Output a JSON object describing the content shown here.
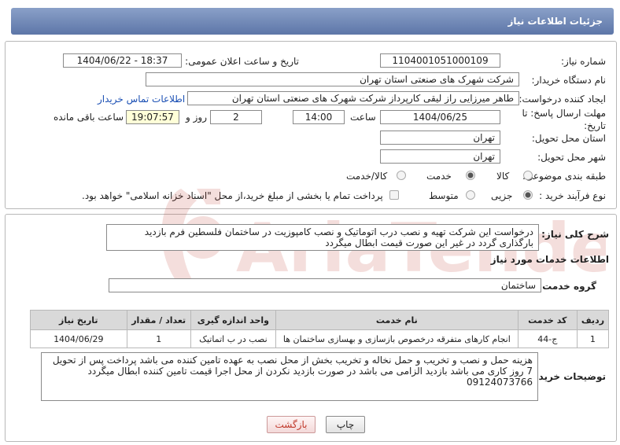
{
  "header": {
    "title": "جزئیات اطلاعات نیاز"
  },
  "form": {
    "need_number_label": "شماره نیاز:",
    "need_number": "1104001051000109",
    "announce_label": "تاریخ و ساعت اعلان عمومی:",
    "announce_value": "1404/06/22 - 18:37",
    "buyer_org_label": "نام دستگاه خریدار:",
    "buyer_org": "شرکت شهرک های صنعتی استان تهران",
    "creator_label": "ایجاد کننده درخواست:",
    "creator": "طاهر  میرزایی راز لیقی کارپرداز شرکت شهرک های صنعتی استان تهران",
    "contact_link": "اطلاعات تماس خریدار",
    "deadline_label": "مهلت ارسال پاسخ: تا تاریخ:",
    "deadline_date": "1404/06/25",
    "time_label": "ساعت",
    "deadline_time": "14:00",
    "days_value": "2",
    "days_label": "روز و",
    "remaining_time": "19:07:57",
    "remaining_label": "ساعت باقی مانده",
    "province_label": "استان محل تحویل:",
    "province": "تهران",
    "city_label": "شهر محل تحویل:",
    "city": "تهران",
    "category_label": "طبقه بندی موضوعی:",
    "category_options": [
      "کالا",
      "خدمت",
      "کالا/خدمت"
    ],
    "category_selected": "خدمت",
    "process_label": "نوع فرآیند خرید :",
    "process_options": [
      "جزیی",
      "متوسط"
    ],
    "process_selected": "جزیی",
    "payment_note": "پرداخت تمام یا بخشی از مبلغ خرید،از محل \"اسناد خزانه اسلامی\" خواهد بود."
  },
  "description": {
    "label": "شرح کلی نیاز:",
    "text": "درخواست این شرکت  تهیه و نصب درب اتوماتیک و  نصب کامپوزیت در ساختمان فلسطین    فرم بازدید بارگذاری گردد در غیر این صورت قیمت  ابطال  میگردد"
  },
  "services": {
    "section_title": "اطلاعات خدمات مورد نیاز",
    "group_label": "گروه خدمت:",
    "group_value": "ساختمان",
    "table": {
      "headers": [
        "ردیف",
        "کد خدمت",
        "نام خدمت",
        "واحد اندازه گیری",
        "تعداد / مقدار",
        "تاریخ نیاز"
      ],
      "rows": [
        [
          "1",
          "ج-44",
          "انجام کارهای متفرقه درخصوص بازسازی و بهسازی ساختمان ها",
          "نصب در ب اتماتیک",
          "1",
          "1404/06/29"
        ]
      ]
    }
  },
  "buyer_notes": {
    "label": "توضیحات خریدار:",
    "text": "هزینه حمل  و نصب و تخریب و حمل نخاله و  تخریب بخش از محل نصب به عهده تامین کننده می باشد پرداخت پس از تحویل 7 روز کاری می باشد  بازدید  الزامی می باشد در صورت بازدید نکردن از محل اجرا  قیمت تامین کننده ابطال میگردد 09124073766"
  },
  "buttons": {
    "print": "چاپ",
    "back": "بازگشت"
  },
  "watermark": {
    "text": "AriaTender.neT"
  }
}
